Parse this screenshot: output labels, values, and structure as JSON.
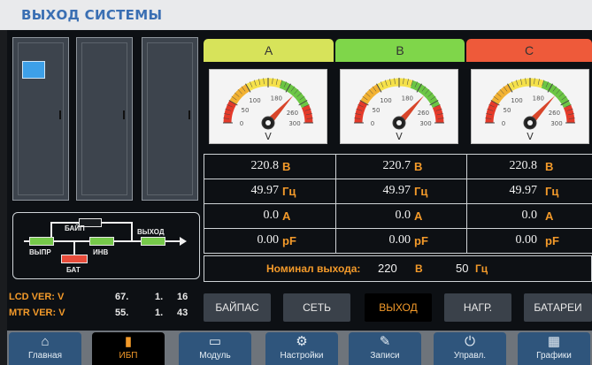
{
  "title": "ВЫХОД СИСТЕМЫ",
  "flow": {
    "bypass": "БАЙП",
    "rect": "ВЫПР",
    "inv": "ИНВ",
    "out": "ВЫХОД",
    "bat": "БАТ"
  },
  "phases": [
    {
      "name": "A",
      "color": "#d7e35a",
      "gauge": {
        "unit": "V",
        "ticks": [
          "0",
          "50",
          "100",
          "180",
          "260",
          "300"
        ],
        "value": 220.8
      }
    },
    {
      "name": "B",
      "color": "#7fd64a",
      "gauge": {
        "unit": "V",
        "ticks": [
          "0",
          "50",
          "100",
          "180",
          "260",
          "300"
        ],
        "value": 220.7
      }
    },
    {
      "name": "C",
      "color": "#ee5a3a",
      "gauge": {
        "unit": "V",
        "ticks": [
          "0",
          "50",
          "100",
          "180",
          "260",
          "300"
        ],
        "value": 220.8
      }
    }
  ],
  "measurements": {
    "units": [
      "В",
      "Гц",
      "А",
      "pF"
    ],
    "rows": [
      [
        "220.8",
        "220.7",
        "220.8"
      ],
      [
        "49.97",
        "49.97",
        "49.97"
      ],
      [
        "0.0",
        "0.0",
        "0.0"
      ],
      [
        "0.00",
        "0.00",
        "0.00"
      ]
    ]
  },
  "nominal": {
    "label": "Номинал выхода:",
    "voltage": "220",
    "voltage_unit": "В",
    "freq": "50",
    "freq_unit": "Гц"
  },
  "versions": {
    "lcd_label": "LCD VER: V",
    "lcd": [
      "67.",
      "1.",
      "16"
    ],
    "mtr_label": "MTR VER: V",
    "mtr": [
      "55.",
      "1.",
      "43"
    ]
  },
  "subtabs": [
    {
      "label": "БАЙПАС"
    },
    {
      "label": "СЕТЬ"
    },
    {
      "label": "ВЫХОД"
    },
    {
      "label": "НАГР."
    },
    {
      "label": "БАТАРЕИ"
    }
  ],
  "subtab_active": "ВЫХОД",
  "nav": [
    {
      "label": "Главная",
      "icon": "home-icon"
    },
    {
      "label": "ИБП",
      "icon": "ups-icon"
    },
    {
      "label": "Модуль",
      "icon": "module-icon"
    },
    {
      "label": "Настройки",
      "icon": "gear-icon"
    },
    {
      "label": "Записи",
      "icon": "records-icon"
    },
    {
      "label": "Управл.",
      "icon": "power-icon"
    },
    {
      "label": "Графики",
      "icon": "chart-icon"
    }
  ],
  "nav_active": "ИБП",
  "colors": {
    "accent": "#f39a2a",
    "title": "#3a6fb3",
    "nav": "#2f557c",
    "gauge_needle": "#d8452a"
  }
}
